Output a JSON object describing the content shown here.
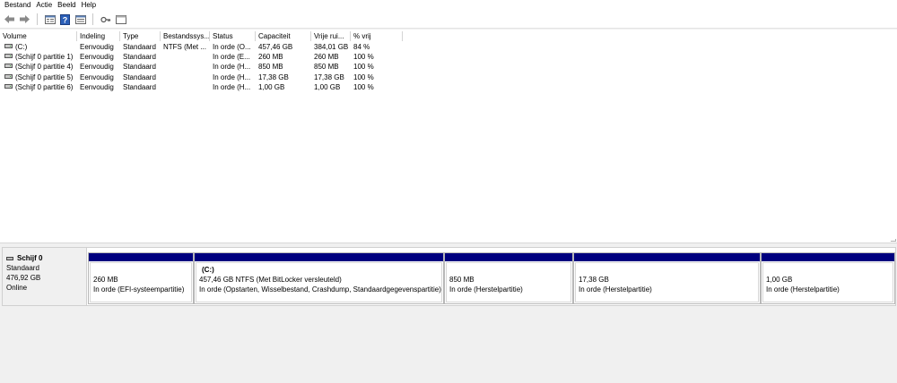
{
  "menu": [
    "Bestand",
    "Actie",
    "Beeld",
    "Help"
  ],
  "toolbar": {
    "icons": [
      "back-arrow-icon",
      "forward-arrow-icon",
      "disk-list-icon",
      "help-icon",
      "properties-icon",
      "key-icon",
      "window-icon"
    ]
  },
  "list": {
    "columns": [
      "Volume",
      "Indeling",
      "Type",
      "Bestandssys...",
      "Status",
      "Capaciteit",
      "Vrije rui...",
      "% vrij"
    ],
    "rows": [
      {
        "volume": "(C:)",
        "indeling": "Eenvoudig",
        "type": "Standaard",
        "fs": "NTFS (Met ...",
        "status": "In orde (O...",
        "capaciteit": "457,46 GB",
        "vrij": "384,01 GB",
        "pct": "84 %"
      },
      {
        "volume": "(Schijf 0 partitie 1)",
        "indeling": "Eenvoudig",
        "type": "Standaard",
        "fs": "",
        "status": "In orde (E...",
        "capaciteit": "260 MB",
        "vrij": "260 MB",
        "pct": "100 %"
      },
      {
        "volume": "(Schijf 0 partitie 4)",
        "indeling": "Eenvoudig",
        "type": "Standaard",
        "fs": "",
        "status": "In orde (H...",
        "capaciteit": "850 MB",
        "vrij": "850 MB",
        "pct": "100 %"
      },
      {
        "volume": "(Schijf 0 partitie 5)",
        "indeling": "Eenvoudig",
        "type": "Standaard",
        "fs": "",
        "status": "In orde (H...",
        "capaciteit": "17,38 GB",
        "vrij": "17,38 GB",
        "pct": "100 %"
      },
      {
        "volume": "(Schijf 0 partitie 6)",
        "indeling": "Eenvoudig",
        "type": "Standaard",
        "fs": "",
        "status": "In orde (H...",
        "capaciteit": "1,00 GB",
        "vrij": "1,00 GB",
        "pct": "100 %"
      }
    ]
  },
  "disk": {
    "name": "Schijf 0",
    "type": "Standaard",
    "size": "476,92 GB",
    "state": "Online",
    "partitions": [
      {
        "name": "",
        "size": "260 MB",
        "status": "In orde (EFI-systeempartitie)"
      },
      {
        "name": "(C:)",
        "size": "457,46 GB NTFS (Met BitLocker versleuteld)",
        "status": "In orde (Opstarten, Wisselbestand, Crashdump, Standaardgegevenspartitie)"
      },
      {
        "name": "",
        "size": "850 MB",
        "status": "In orde (Herstelpartitie)"
      },
      {
        "name": "",
        "size": "17,38 GB",
        "status": "In orde (Herstelpartitie)"
      },
      {
        "name": "",
        "size": "1,00 GB",
        "status": "In orde (Herstelpartitie)"
      }
    ]
  },
  "colors": {
    "partition_bar": "#00007f",
    "pane_bg": "#f0f0f0"
  }
}
